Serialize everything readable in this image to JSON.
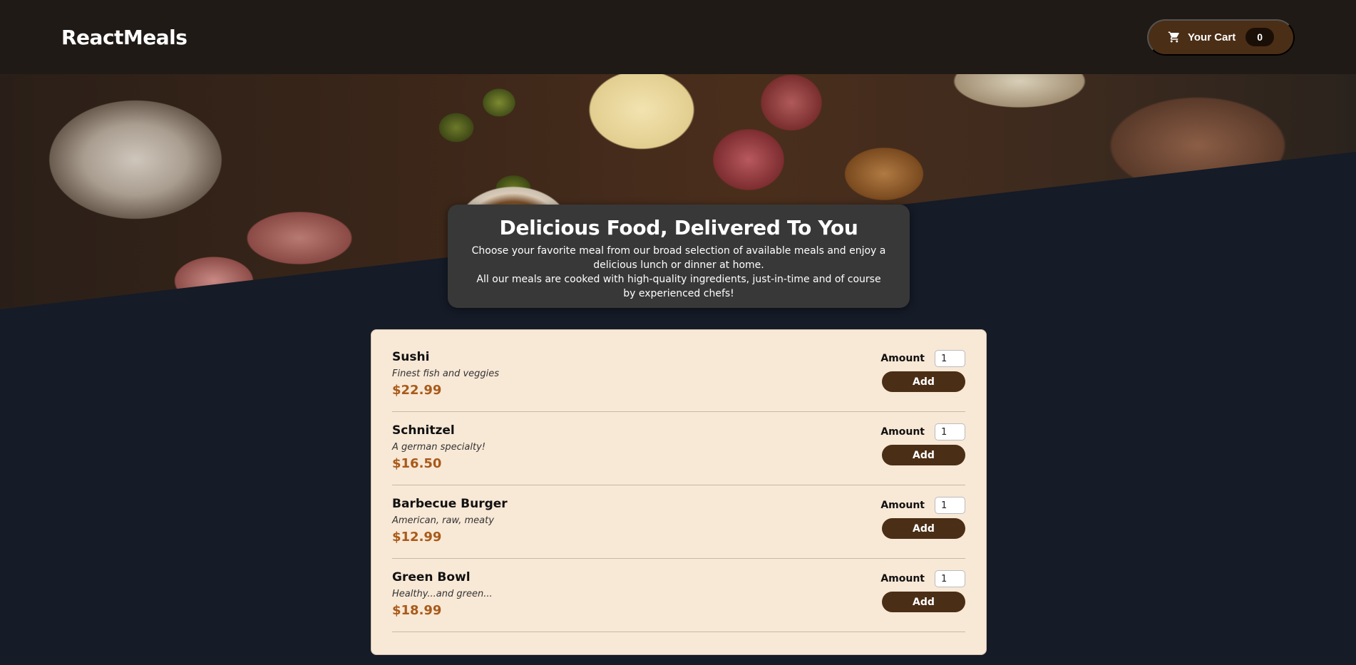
{
  "header": {
    "logo": "ReactMeals",
    "cart": {
      "label": "Your Cart",
      "count": "0",
      "icon": "shopping-cart-icon"
    }
  },
  "hero": {
    "image": "food-platter-image"
  },
  "summary": {
    "title": "Delicious Food, Delivered To You",
    "paragraph1": "Choose your favorite meal from our broad selection of available meals and enjoy a delicious lunch or dinner at home.",
    "paragraph2": "All our meals are cooked with high-quality ingredients, just-in-time and of course by experienced chefs!"
  },
  "meals": [
    {
      "name": "Sushi",
      "description": "Finest fish and veggies",
      "price": "$22.99",
      "amount_label": "Amount",
      "amount": "1",
      "add_label": "Add"
    },
    {
      "name": "Schnitzel",
      "description": "A german specialty!",
      "price": "$16.50",
      "amount_label": "Amount",
      "amount": "1",
      "add_label": "Add"
    },
    {
      "name": "Barbecue Burger",
      "description": "American, raw, meaty",
      "price": "$12.99",
      "amount_label": "Amount",
      "amount": "1",
      "add_label": "Add"
    },
    {
      "name": "Green Bowl",
      "description": "Healthy...and green...",
      "price": "$18.99",
      "amount_label": "Amount",
      "amount": "1",
      "add_label": "Add"
    }
  ],
  "colors": {
    "header_bg": "#1f1a16",
    "page_bg": "#151b27",
    "accent_brown": "#4b2e16",
    "price": "#a85a1a",
    "card_bg": "#f8e8d6"
  }
}
